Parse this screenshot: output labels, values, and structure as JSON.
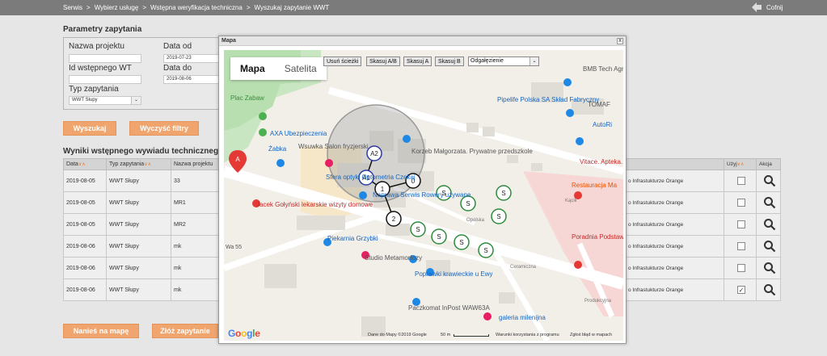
{
  "breadcrumb": [
    "Serwis",
    "Wybierz usługę",
    "Wstępna weryfikacja techniczna",
    "Wyszukaj zapytanie WWT"
  ],
  "breadcrumb_sep": ">",
  "back_label": "Cofnij",
  "params": {
    "title": "Parametry zapytania",
    "nazwa_projektu_label": "Nazwa projektu",
    "nazwa_projektu_value": "",
    "data_od_label": "Data od",
    "data_od_value": "2019-07-23",
    "id_wt_label": "Id wstępnego WT",
    "id_wt_value": "",
    "data_do_label": "Data do",
    "data_do_value": "2019-08-06",
    "typ_label": "Typ zapytania",
    "typ_value": "WWT Słupy"
  },
  "buttons": {
    "wyszukaj": "Wyszukaj",
    "wyczysc": "Wyczyść filtry",
    "nanies": "Nanieś na mapę",
    "zloz": "Złóż zapytanie"
  },
  "results": {
    "title": "Wyniki wstępnego wywiadu technicznego",
    "headers": [
      "Data",
      "Typ zapytania",
      "Nazwa projektu"
    ],
    "sort_mark": "∨∧",
    "rows": [
      [
        "2019-08-05",
        "WWT Słupy",
        "33"
      ],
      [
        "2019-08-05",
        "WWT Słupy",
        "MR1"
      ],
      [
        "2019-08-05",
        "WWT Słupy",
        "MR2"
      ],
      [
        "2019-08-06",
        "WWT Słupy",
        "mk"
      ],
      [
        "2019-08-06",
        "WWT Słupy",
        "mk"
      ],
      [
        "2019-08-06",
        "WWT Słupy",
        "mk"
      ]
    ],
    "right_text": "o Infrastukturze Orange",
    "col_uzyj": "Użyj",
    "col_akcja": "Akcja",
    "checked": [
      false,
      false,
      false,
      false,
      false,
      true
    ]
  },
  "modal": {
    "title": "Mapa",
    "close": "x",
    "map_type": [
      "Mapa",
      "Satelita"
    ],
    "controls": [
      "Usuń ścieżki",
      "Skasuj A/B",
      "Skasuj A",
      "Skasuj B"
    ],
    "select_value": "Odgałęzienie",
    "footer": {
      "data": "Dane do Mapy ©2019 Google",
      "scale": "50 m",
      "terms": "Warunki korzystania z programu",
      "report": "Zgłoś błąd w mapach",
      "google": "Google"
    },
    "places": [
      "Plac Zabaw",
      "AXA Ubezpieczenia",
      "Żabka",
      "Wsuwka Salon fryzjerski",
      "Korzeb Małgorzata. Prywatne przedszkole",
      "Sfera optyki Optometria Czekaj",
      "Jacek Gołyński lekarskie wizyty domowe",
      "Naprawa Serwis Rowery używane",
      "Piekarnia Grzybki",
      "Studio Metamorfozy",
      "Poprawki krawieckie u Ewy",
      "Paczkomat InPost WAW63A",
      "galeria milenijna",
      "Pipelife Polska SA Skład Fabryczny",
      "BMB Tech Agregaty",
      "TOMAF",
      "AutoRi",
      "Vitace. Apteka. Ci",
      "Restauracja Ma",
      "Poradnia Podstaw Opieki Zdrowotn",
      "Ceramiczna",
      "Kącik",
      "Produkcyjna",
      "Opolska",
      "Wa 55"
    ],
    "markers": {
      "a2": "A2",
      "a1": "A1",
      "p1": "1",
      "p0": "0",
      "p2": "2",
      "s": "S",
      "pin": "A"
    }
  }
}
